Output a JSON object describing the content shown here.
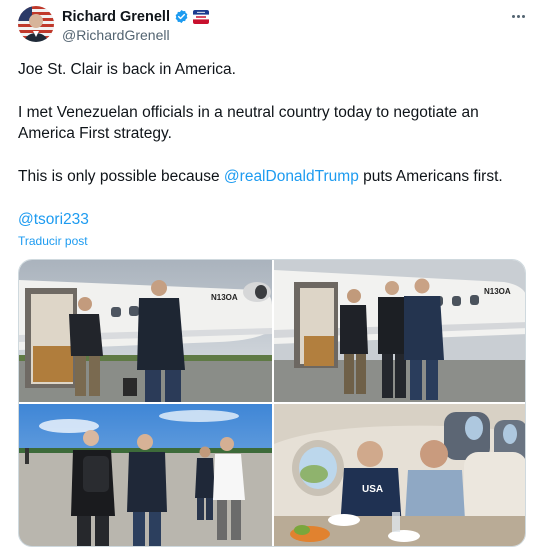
{
  "author": {
    "display_name": "Richard Grenell",
    "handle": "@RichardGrenell",
    "verified_icon": "verified-badge-icon",
    "affiliation_icon": "flag-affiliation-icon"
  },
  "tweet": {
    "line1": "Joe St. Clair is back in America.",
    "line2": "I met Venezuelan officials in a neutral country today to negotiate an America First strategy.",
    "line3_prefix": "This is only possible because ",
    "line3_mention": "@realDonaldTrump",
    "line3_suffix": " puts Americans first.",
    "line4_mention": "@tsori233",
    "translate_label": "Traducir post"
  },
  "media": {
    "tail_number": "N13OA",
    "shirt_text": "USA"
  },
  "colors": {
    "link": "#1d9bf0",
    "text": "#0f1419",
    "secondary": "#536471",
    "border": "#cfd9de"
  }
}
